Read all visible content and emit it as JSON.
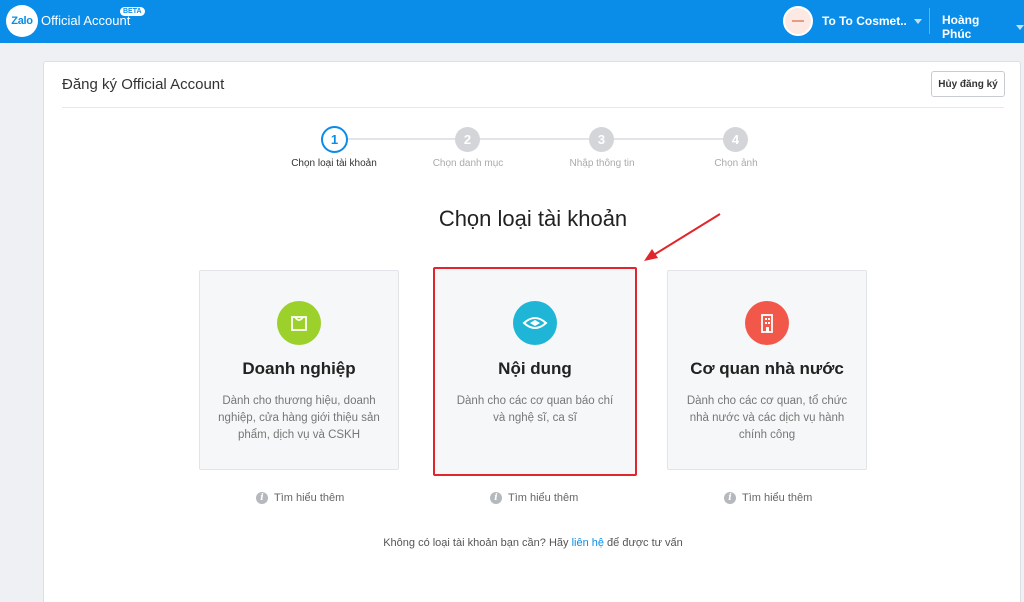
{
  "topbar": {
    "logo_text": "Zalo",
    "brand": "Official Account",
    "beta": "BETA",
    "account_name": "To To Cosmet...",
    "user_name": "Hoàng Phúc"
  },
  "panel": {
    "title": "Đăng ký Official Account",
    "cancel_label": "Hủy đăng ký"
  },
  "steps": [
    {
      "number": "1",
      "label": "Chọn loại tài khoản",
      "active": true
    },
    {
      "number": "2",
      "label": "Chọn danh mục",
      "active": false
    },
    {
      "number": "3",
      "label": "Nhập thông tin",
      "active": false
    },
    {
      "number": "4",
      "label": "Chọn ảnh",
      "active": false
    }
  ],
  "heading": "Chọn loại tài khoản",
  "cards": [
    {
      "title": "Doanh nghiệp",
      "desc": "Dành cho thương hiệu, doanh nghiệp, cửa hàng giới thiệu sản phẩm, dịch vụ và CSKH",
      "icon": "shopping-bag-icon",
      "color": "#9bd12a"
    },
    {
      "title": "Nội dung",
      "desc": "Dành cho các cơ quan báo chí và nghệ sĩ, ca sĩ",
      "icon": "content-icon",
      "color": "#1fb5d6"
    },
    {
      "title": "Cơ quan nhà nước",
      "desc": "Dành cho các cơ quan, tổ chức nhà nước và các dịch vụ hành chính công",
      "icon": "building-icon",
      "color": "#f2584a"
    }
  ],
  "learn_more": "Tìm hiểu thêm",
  "footer": {
    "before": "Không có loại tài khoản bạn cần? Hãy ",
    "link": "liên hệ",
    "after": " để được tư vấn"
  },
  "colors": {
    "primary": "#0a8de8",
    "highlight": "#e1262b"
  }
}
